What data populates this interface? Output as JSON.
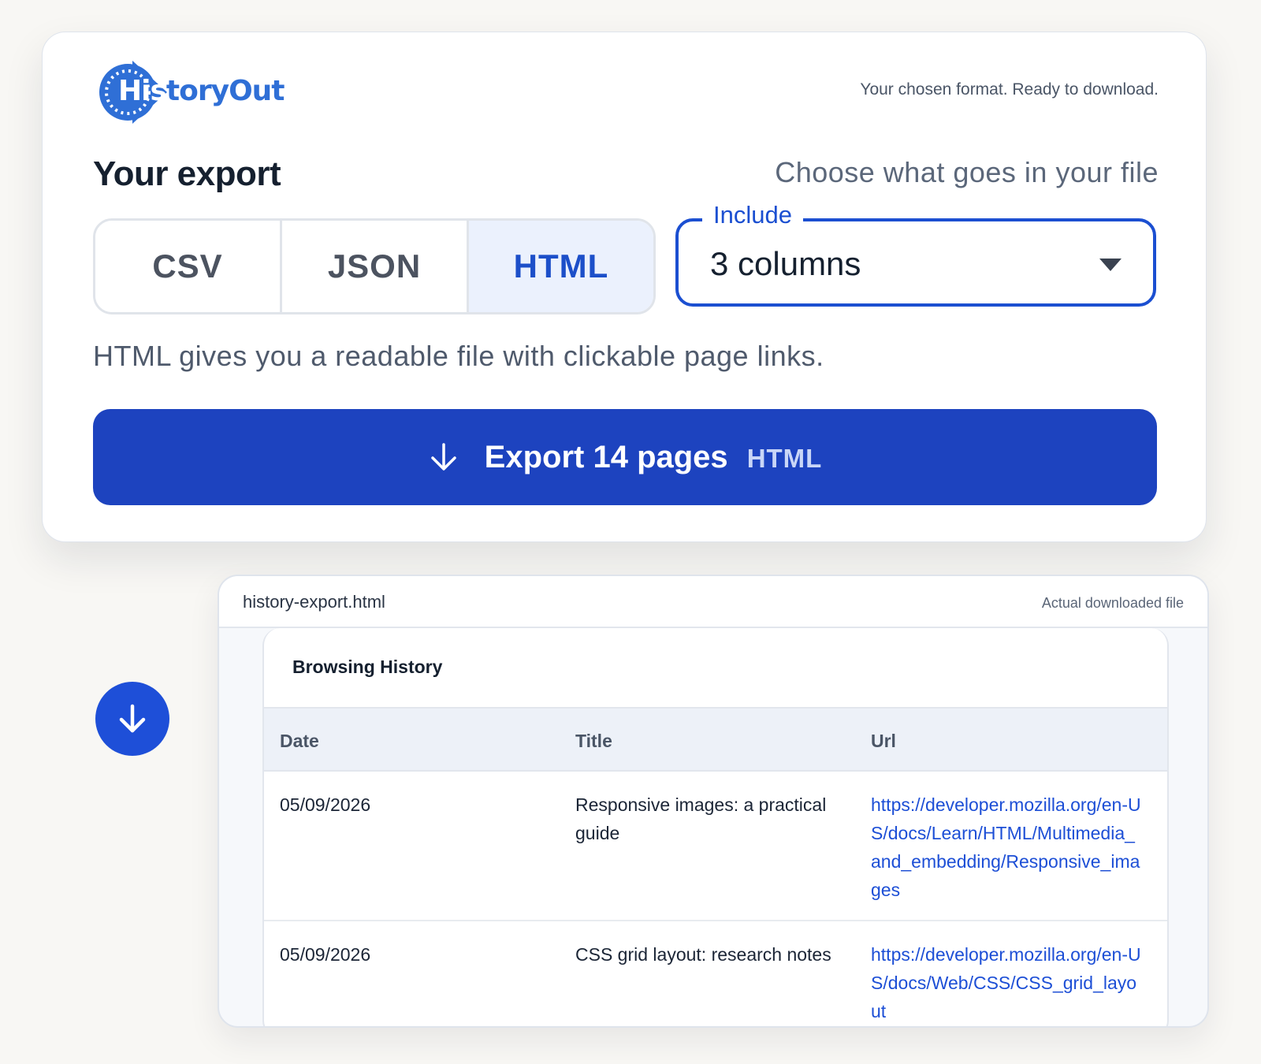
{
  "app": {
    "logo_text": "HistoryOut",
    "logo_prefix": "His",
    "logo_suffix": "toryOut"
  },
  "header": {
    "status": "Your chosen format. Ready to download."
  },
  "export": {
    "title": "Your export",
    "subtitle": "Choose what goes in your file",
    "formats": [
      {
        "label": "CSV",
        "active": false
      },
      {
        "label": "JSON",
        "active": false
      },
      {
        "label": "HTML",
        "active": true
      }
    ],
    "include_label": "Include",
    "include_value": "3 columns",
    "description": "HTML gives you a readable file with clickable page links.",
    "button_label": "Export 14 pages",
    "button_format": "HTML"
  },
  "preview": {
    "file_name": "history-export.html",
    "note": "Actual downloaded file",
    "doc_title": "Browsing History",
    "columns": [
      "Date",
      "Title",
      "Url"
    ],
    "rows": [
      {
        "date": "05/09/2026",
        "title": "Responsive images: a practical guide",
        "url": "https://developer.mozilla.org/en-US/docs/Learn/HTML/Multimedia_and_embedding/Responsive_images"
      },
      {
        "date": "05/09/2026",
        "title": "CSS grid layout: research notes",
        "url": "https://developer.mozilla.org/en-US/docs/Web/CSS/CSS_grid_layout"
      }
    ]
  },
  "colors": {
    "accent": "#1d43bf",
    "link": "#1d4fd6",
    "active_bg": "#ebf1fd"
  },
  "icons": {
    "export": "arrow-down-icon",
    "download": "download-icon",
    "dropdown": "caret-down-icon"
  }
}
